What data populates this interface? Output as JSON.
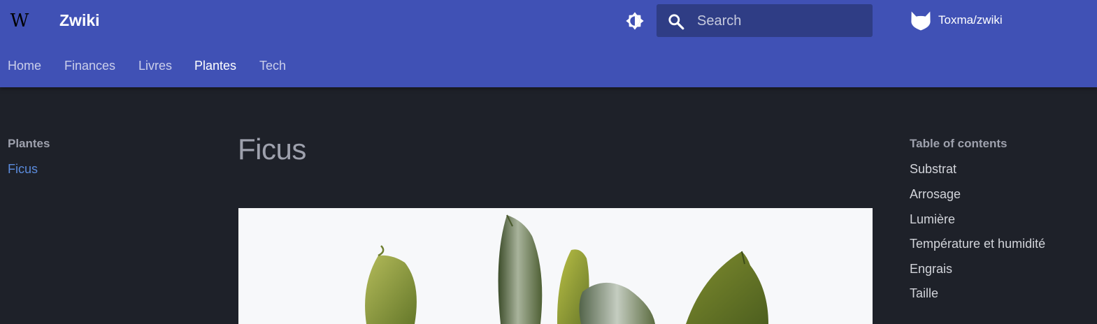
{
  "header": {
    "site_title": "Zwiki",
    "search": {
      "placeholder": "Search"
    },
    "repo": {
      "name": "Toxma/zwiki"
    }
  },
  "tabs": [
    {
      "label": "Home",
      "active": false
    },
    {
      "label": "Finances",
      "active": false
    },
    {
      "label": "Livres",
      "active": false
    },
    {
      "label": "Plantes",
      "active": true
    },
    {
      "label": "Tech",
      "active": false
    }
  ],
  "sidebar": {
    "title": "Plantes",
    "items": [
      {
        "label": "Ficus",
        "active": true
      }
    ]
  },
  "main": {
    "title": "Ficus",
    "image_subject": "ficus plant leaves on white background"
  },
  "toc": {
    "title": "Table of contents",
    "items": [
      {
        "label": "Substrat"
      },
      {
        "label": "Arrosage"
      },
      {
        "label": "Lumière"
      },
      {
        "label": "Température et humidité"
      },
      {
        "label": "Engrais"
      },
      {
        "label": "Taille"
      }
    ]
  },
  "colors": {
    "header_bg": "#4051b5",
    "page_bg": "#1e2129",
    "search_bg": "#2f3d85",
    "link": "#5b8bdc"
  },
  "icons": {
    "logo": "wikipedia-w-icon",
    "theme": "brightness-toggle-icon",
    "search": "search-icon",
    "repo": "gitlab-icon"
  }
}
